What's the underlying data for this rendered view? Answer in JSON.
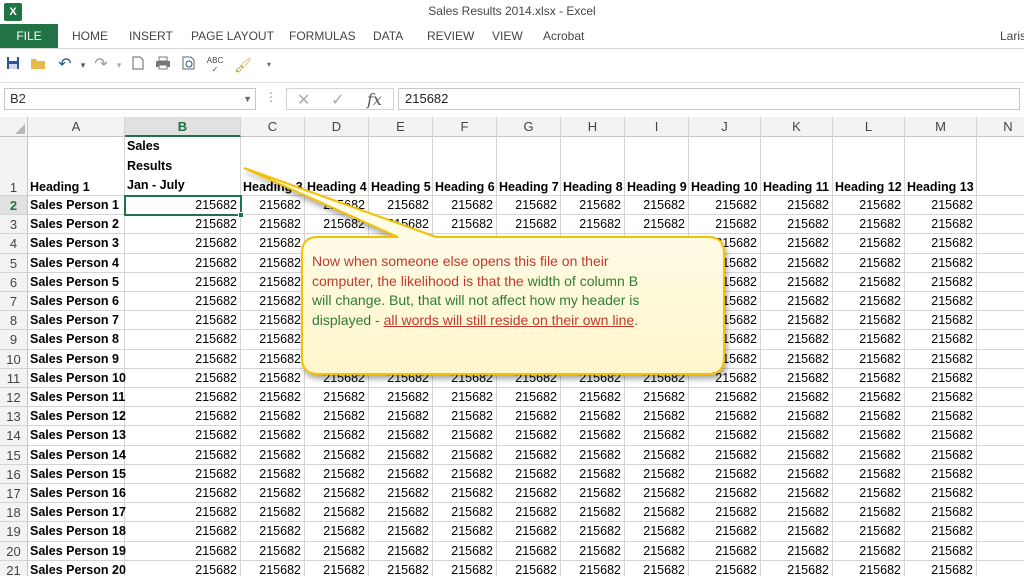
{
  "window": {
    "title": "Sales Results 2014.xlsx - Excel",
    "app_icon": "X",
    "user": "Laris"
  },
  "ribbon": {
    "tabs": [
      "FILE",
      "HOME",
      "INSERT",
      "PAGE LAYOUT",
      "FORMULAS",
      "DATA",
      "REVIEW",
      "VIEW",
      "Acrobat"
    ]
  },
  "qat": {
    "icons": [
      "save-icon",
      "open-folder-icon",
      "undo-icon",
      "redo-icon",
      "new-document-icon",
      "print-icon",
      "print-preview-icon",
      "spelling-icon",
      "format-painter-icon",
      "customize-qat-icon"
    ]
  },
  "formula_bar": {
    "name_box": "B2",
    "formula": "215682",
    "fx": "fx"
  },
  "colors": {
    "excel_green": "#217346",
    "callout_fill": "#fffde8",
    "callout_border": "#f2c200",
    "callout_red": "#c0392b",
    "callout_green": "#2e7d32"
  },
  "sheet": {
    "columns": [
      "A",
      "B",
      "C",
      "D",
      "E",
      "F",
      "G",
      "H",
      "I",
      "J",
      "K",
      "L",
      "M",
      "N"
    ],
    "selected_column": "B",
    "active_cell": "B2",
    "header_row": {
      "a": "Heading 1",
      "b_lines": [
        "Sales",
        "Results",
        "Jan - July"
      ],
      "others": [
        "Heading 3",
        "Heading 4",
        "Heading 5",
        "Heading 6",
        "Heading 7",
        "Heading 8",
        "Heading 9",
        "Heading 10",
        "Heading 11",
        "Heading 12",
        "Heading 13"
      ]
    },
    "row_numbers": [
      "1",
      "2",
      "3",
      "4",
      "5",
      "6",
      "7",
      "8",
      "9",
      "10",
      "11",
      "12",
      "13",
      "14",
      "15",
      "16",
      "17",
      "18",
      "19",
      "20",
      "21"
    ],
    "row_labels": [
      "Sales Person 1",
      "Sales Person 2",
      "Sales Person 3",
      "Sales Person 4",
      "Sales Person 5",
      "Sales Person 6",
      "Sales Person 7",
      "Sales Person 8",
      "Sales Person 9",
      "Sales Person 10",
      "Sales Person 11",
      "Sales Person 12",
      "Sales Person 13",
      "Sales Person 14",
      "Sales Person 15",
      "Sales Person 16",
      "Sales Person 17",
      "Sales Person 18",
      "Sales Person 19",
      "Sales Person 20"
    ],
    "cell_value": "215682"
  },
  "callout": {
    "line1": "Now when someone else opens this file on their",
    "line2_a": "computer, the likelihood is that the ",
    "line2_b": "width of column B",
    "line3_a": "will change. But, that will not affect how my header is",
    "line4_a": "displayed - ",
    "line4_b": "all words will still reside on their own line",
    "line4_c": "."
  }
}
